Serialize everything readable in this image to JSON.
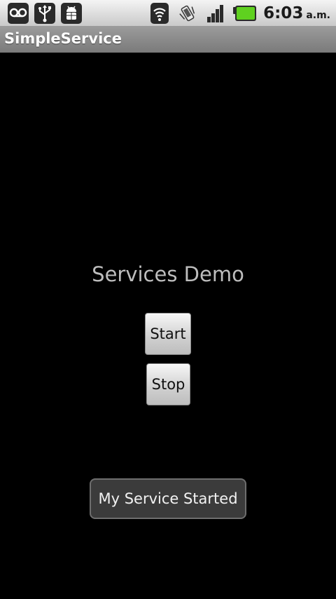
{
  "status_bar": {
    "left_icons": [
      "voicemail-icon",
      "usb-icon",
      "android-debug-icon"
    ],
    "right_icons": [
      "wifi-icon",
      "vibrate-icon",
      "signal-icon",
      "battery-icon"
    ],
    "time": "6:03",
    "ampm": "a.m.",
    "battery_color": "#5fd11f"
  },
  "app_bar": {
    "title": "SimpleService"
  },
  "main": {
    "heading": "Services Demo",
    "start_label": "Start",
    "stop_label": "Stop"
  },
  "toast": {
    "message": "My Service Started"
  }
}
